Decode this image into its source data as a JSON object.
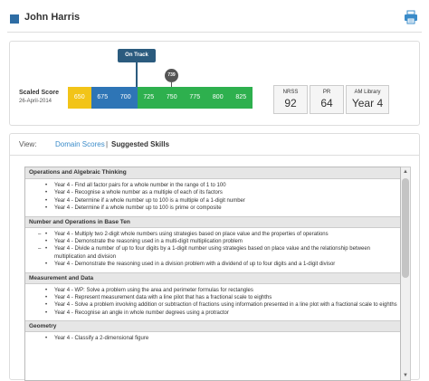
{
  "header": {
    "student_name": "John Harris",
    "print_icon": "printer-icon"
  },
  "score": {
    "label": "Scaled Score",
    "date": "26-April-2014",
    "bands": [
      "650",
      "675",
      "700",
      "725",
      "750",
      "775",
      "800",
      "825"
    ],
    "band_colors": [
      "#f2c418",
      "#2e75b6",
      "#2e75b6",
      "#2eb04e",
      "#2eb04e",
      "#2eb04e",
      "#2eb04e",
      "#2eb04e"
    ],
    "on_track_label": "On Track",
    "student_score": "739"
  },
  "stats": [
    {
      "label": "NRSS",
      "value": "92"
    },
    {
      "label": "PR",
      "value": "64"
    },
    {
      "label": "AM Library",
      "value": "Year 4"
    }
  ],
  "view": {
    "label": "View:",
    "domain_link": "Domain Scores",
    "separator": "|",
    "active": "Suggested Skills"
  },
  "categories": [
    {
      "title": "Operations and Algebraic Thinking",
      "skills": [
        "Year 4 - Find all factor pairs for a whole number in the range of 1 to 100",
        "Year 4 - Recognise a whole number as a multiple of each of its factors",
        "Year 4 - Determine if a whole number up to 100 is a multiple of a 1-digit number",
        "Year 4 - Determine if a whole number up to 100 is prime or composite"
      ]
    },
    {
      "title": "Number and Operations in Base Ten",
      "skills": [
        "Year 4 - Multiply two 2-digit whole numbers using strategies based on place value and the properties of operations",
        "Year 4 - Demonstrate the reasoning used in a multi-digit multiplication problem",
        "Year 4 - Divide a number of up to four digits by a 1-digit number using strategies based on place value and the relationship between multiplication and division",
        "Year 4 - Demonstrate the reasoning used in a division problem with a dividend of up to four digits and a 1-digit divisor"
      ]
    },
    {
      "title": "Measurement and Data",
      "skills": [
        "Year 4 - WP: Solve a problem using the area and perimeter formulas for rectangles",
        "Year 4 - Represent measurement data with a line pilot that has a fractional scale to eighths",
        "Year 4 - Solve a problem involving addition or subtraction of fractions using information presented in a line plot with a fractional scale to eighths",
        "Year 4 - Recognise an angle in whole number degrees using a protractor"
      ]
    },
    {
      "title": "Geometry",
      "skills": [
        "Year 4 - Classify a 2-dimensional figure"
      ]
    }
  ]
}
